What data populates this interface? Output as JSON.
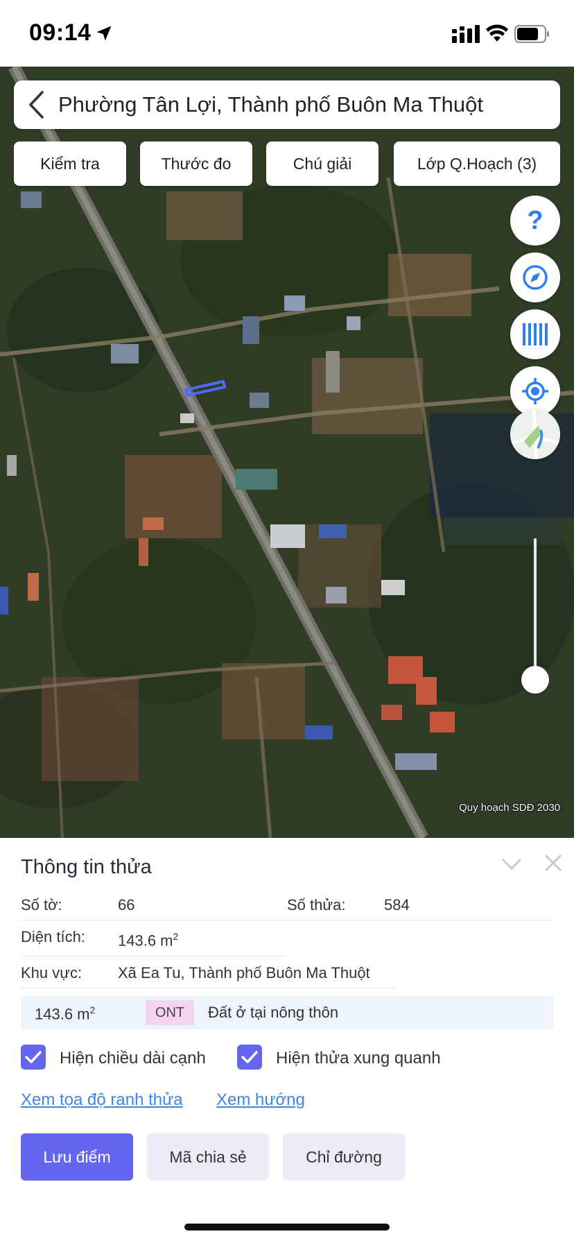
{
  "status_bar": {
    "time": "09:14",
    "icons": [
      "location-arrow-icon",
      "signal-icon",
      "wifi-icon",
      "battery-icon"
    ]
  },
  "map": {
    "search_text": "Phường Tân Lợi, Thành phố Buôn Ma Thuột",
    "toolbar": {
      "check": "Kiểm tra",
      "ruler": "Thước đo",
      "legend": "Chú giải",
      "layers": "Lớp Q.Hoạch (3)"
    },
    "side_buttons": [
      "help-icon",
      "compass-icon",
      "barcode-icon",
      "locate-icon",
      "map-thumbnail-icon"
    ],
    "help_glyph": "?",
    "attribution": "Quy hoạch SDĐ 2030"
  },
  "panel": {
    "title": "Thông tin thửa",
    "sheet_label": "Số tờ:",
    "sheet_value": "66",
    "parcel_label": "Số thửa:",
    "parcel_value": "584",
    "area_label": "Diện tích:",
    "area_value": "143.6 m",
    "area_unit_sup": "2",
    "region_label": "Khu vực:",
    "region_value": "Xã Ea Tu, Thành phố Buôn Ma Thuột",
    "zone": {
      "area": "143.6 m",
      "area_sup": "2",
      "code": "ONT",
      "description": "Đất ở tại nông thôn"
    },
    "checkbox_edges": "Hiện chiều dài cạnh",
    "checkbox_neighbors": "Hiện thửa xung quanh",
    "link_coords": "Xem tọa độ ranh thửa",
    "link_direction": "Xem hướng",
    "btn_save": "Lưu điểm",
    "btn_share": "Mã chia sẻ",
    "btn_directions": "Chỉ đường"
  },
  "colors": {
    "accent": "#6566f0",
    "link": "#3d86e8",
    "zone_bg": "#eef4fb",
    "zone_code_bg": "#f6d3ef"
  }
}
